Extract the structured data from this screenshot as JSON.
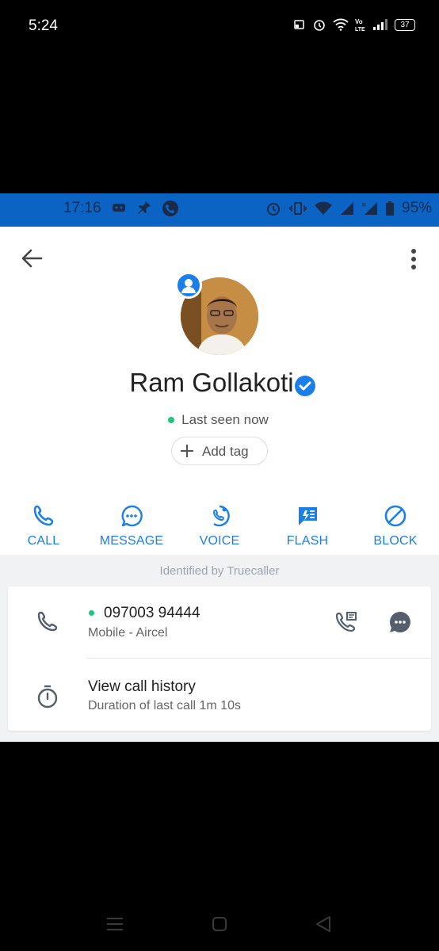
{
  "outer_status": {
    "time": "5:24",
    "battery": "37"
  },
  "inner_status": {
    "time": "17:16",
    "battery": "95%"
  },
  "contact": {
    "name": "Ram Gollakoti",
    "last_seen": "Last seen now",
    "add_tag": "Add tag"
  },
  "actions": [
    {
      "label": "CALL",
      "icon": "phone-icon"
    },
    {
      "label": "MESSAGE",
      "icon": "chat-bubble-icon"
    },
    {
      "label": "VOICE",
      "icon": "voice-call-icon"
    },
    {
      "label": "FLASH",
      "icon": "flash-message-icon"
    },
    {
      "label": "BLOCK",
      "icon": "block-icon"
    }
  ],
  "identified_by": "Identified by Truecaller",
  "phone": {
    "number": "097003 94444",
    "type": "Mobile - Aircel"
  },
  "history": {
    "title": "View call history",
    "subtitle": "Duration of last call 1m 10s"
  },
  "colors": {
    "accent": "#1a7fe8",
    "status_bar": "#0b63c4",
    "online": "#1fc47f"
  }
}
